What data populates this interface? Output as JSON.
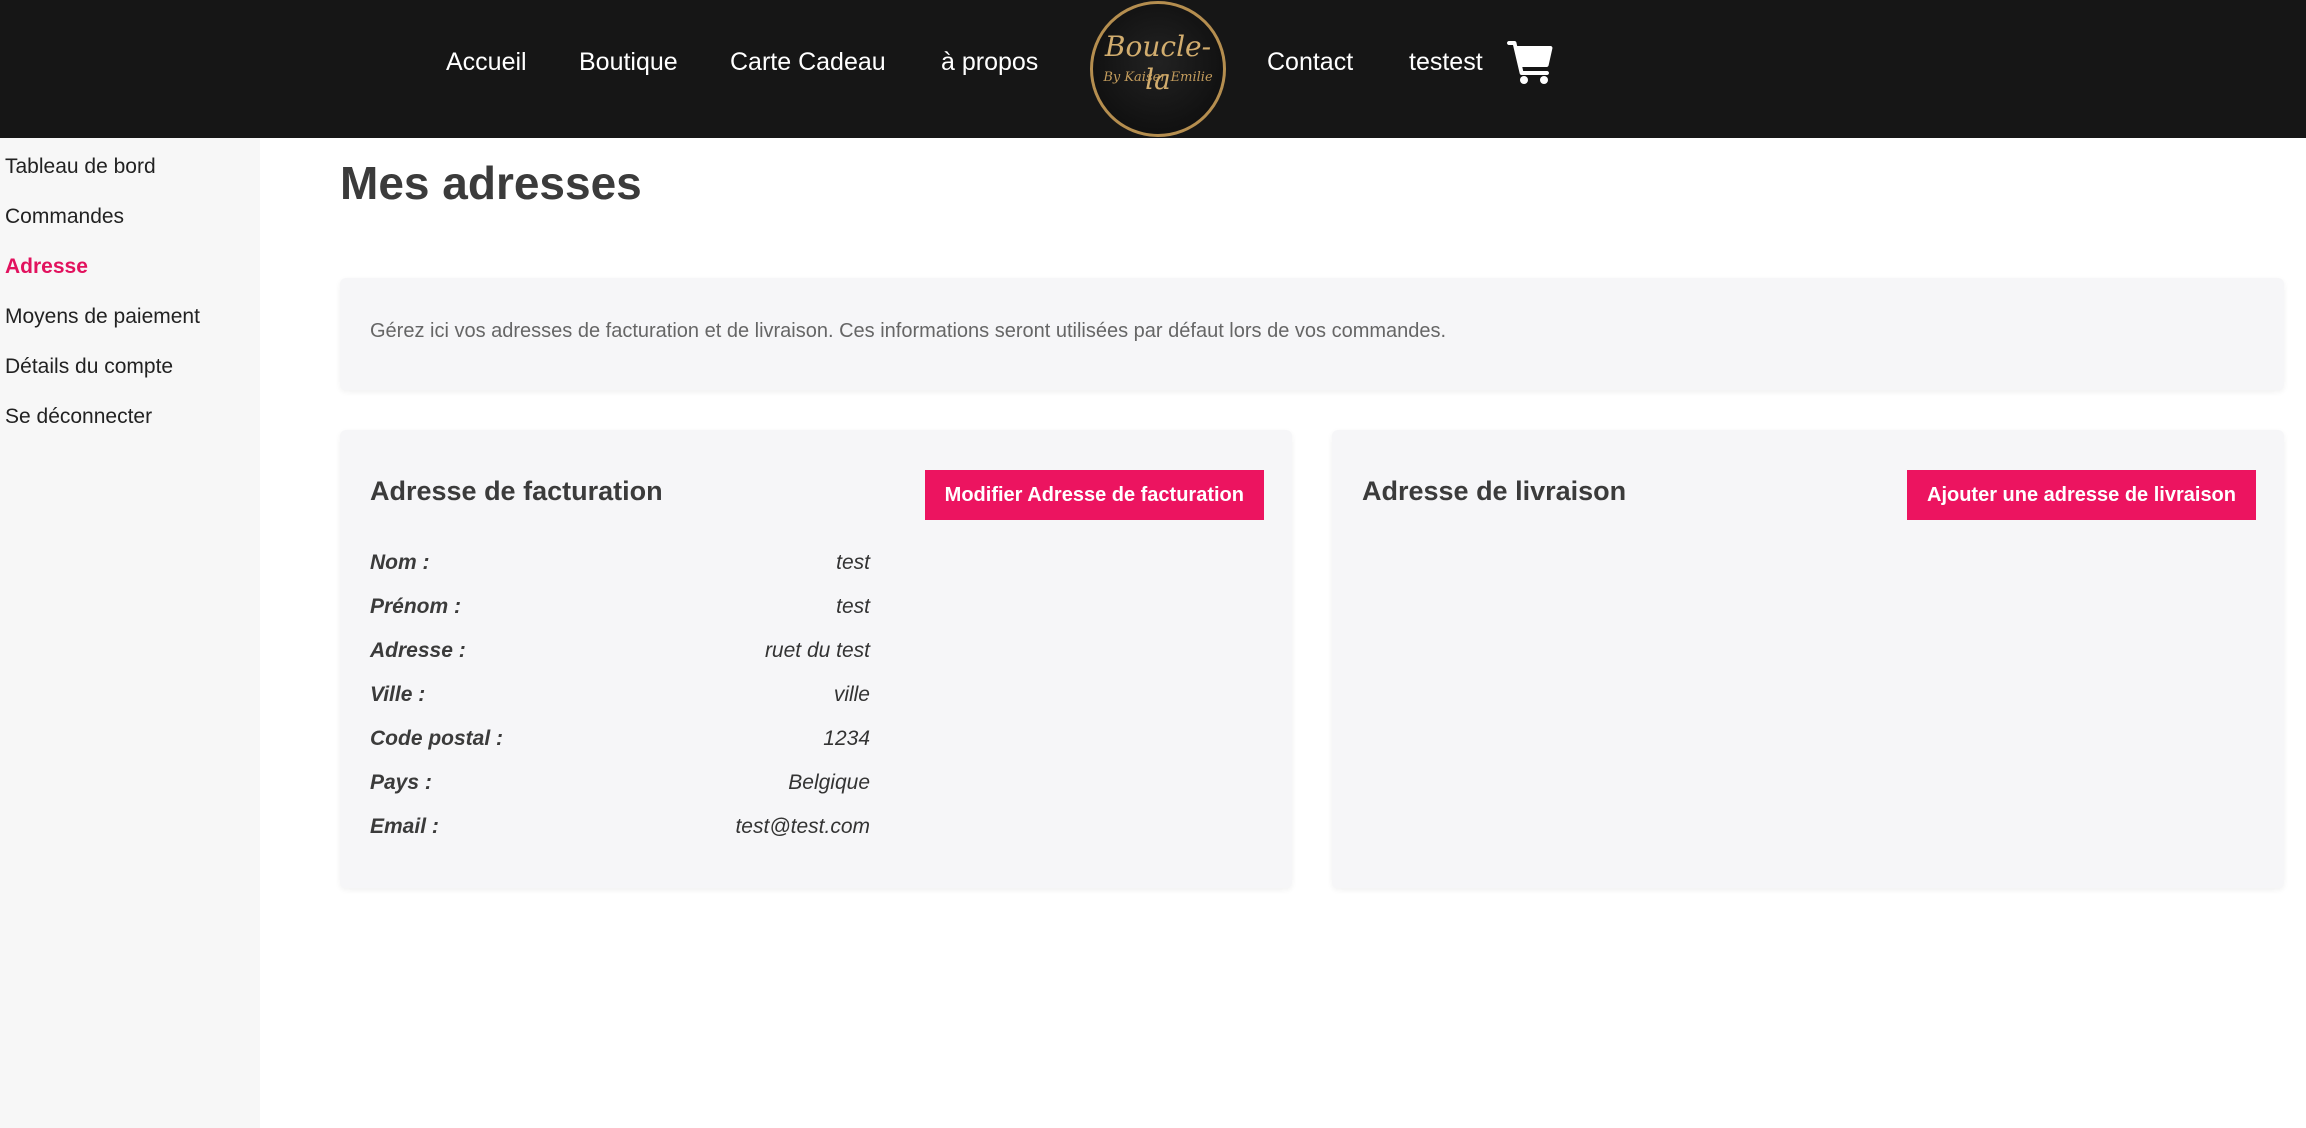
{
  "nav": {
    "items": [
      "Accueil",
      "Boutique",
      "Carte Cadeau",
      "à propos"
    ],
    "items_right": [
      "Contact",
      "testest"
    ],
    "logo_title": "Boucle-la",
    "logo_subtitle": "By Kaiser Emilie",
    "cart_icon": "shopping-cart-icon"
  },
  "sidebar": {
    "items": [
      {
        "label": "Tableau de bord"
      },
      {
        "label": "Commandes"
      },
      {
        "label": "Adresse"
      },
      {
        "label": "Moyens de paiement"
      },
      {
        "label": "Détails du compte"
      },
      {
        "label": "Se déconnecter"
      }
    ],
    "active_index": 2
  },
  "main": {
    "title": "Mes adresses",
    "info": "Gérez ici vos adresses de facturation et de livraison. Ces informations seront utilisées par défaut lors de vos commandes.",
    "billing": {
      "title": "Adresse de facturation",
      "button": "Modifier Adresse de facturation",
      "fields": [
        {
          "label": "Nom :",
          "value": "test"
        },
        {
          "label": "Prénom :",
          "value": "test"
        },
        {
          "label": "Adresse :",
          "value": "ruet du test"
        },
        {
          "label": "Ville :",
          "value": "ville"
        },
        {
          "label": "Code postal :",
          "value": "1234"
        },
        {
          "label": "Pays :",
          "value": "Belgique"
        },
        {
          "label": "Email :",
          "value": "test@test.com"
        }
      ]
    },
    "shipping": {
      "title": "Adresse de livraison",
      "button": "Ajouter une adresse de livraison"
    }
  },
  "colors": {
    "accent": "#ec1460",
    "header_bg": "#161616",
    "sidebar_bg": "#f7f7f7",
    "card_bg": "#f6f6f8",
    "logo_gold": "#c39c5c"
  }
}
